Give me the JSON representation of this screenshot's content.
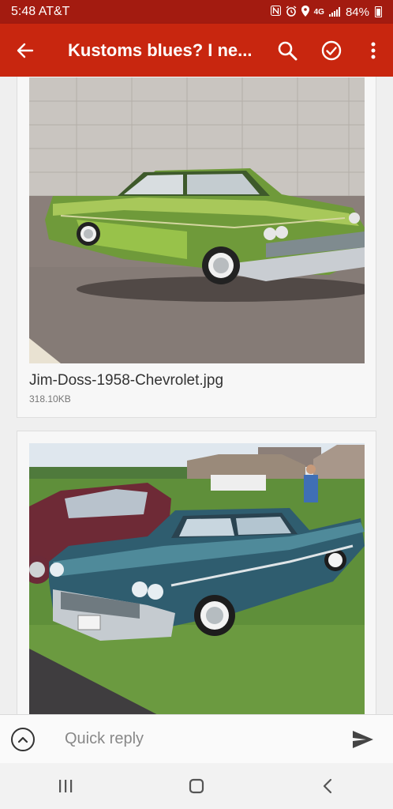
{
  "status": {
    "time": "5:48",
    "carrier": "AT&T",
    "network": "4G",
    "battery": "84%",
    "icons": [
      "nfc-icon",
      "alarm-icon",
      "location-icon",
      "wifi-calling-icon",
      "signal-icon",
      "battery-icon"
    ]
  },
  "app_bar": {
    "title": "Kustoms blues? I ne...",
    "back_icon": "arrow-back-icon",
    "search_icon": "search-icon",
    "done_icon": "check-circle-icon",
    "menu_icon": "more-vert-icon",
    "color": "#c8260f"
  },
  "attachments": [
    {
      "filename": "Jim-Doss-1958-Chevrolet.jpg",
      "size": "318.10KB",
      "image": "green 1958 Chevrolet custom car parked by wall"
    },
    {
      "image": "blue 1958 Chevrolet custom car on grass at car show"
    }
  ],
  "reply": {
    "placeholder": "Quick reply",
    "expand_icon": "chevron-up-circle-icon",
    "send_icon": "send-icon"
  },
  "nav": {
    "recents_icon": "recents-icon",
    "home_icon": "home-icon",
    "back_icon": "back-chevron-icon"
  }
}
